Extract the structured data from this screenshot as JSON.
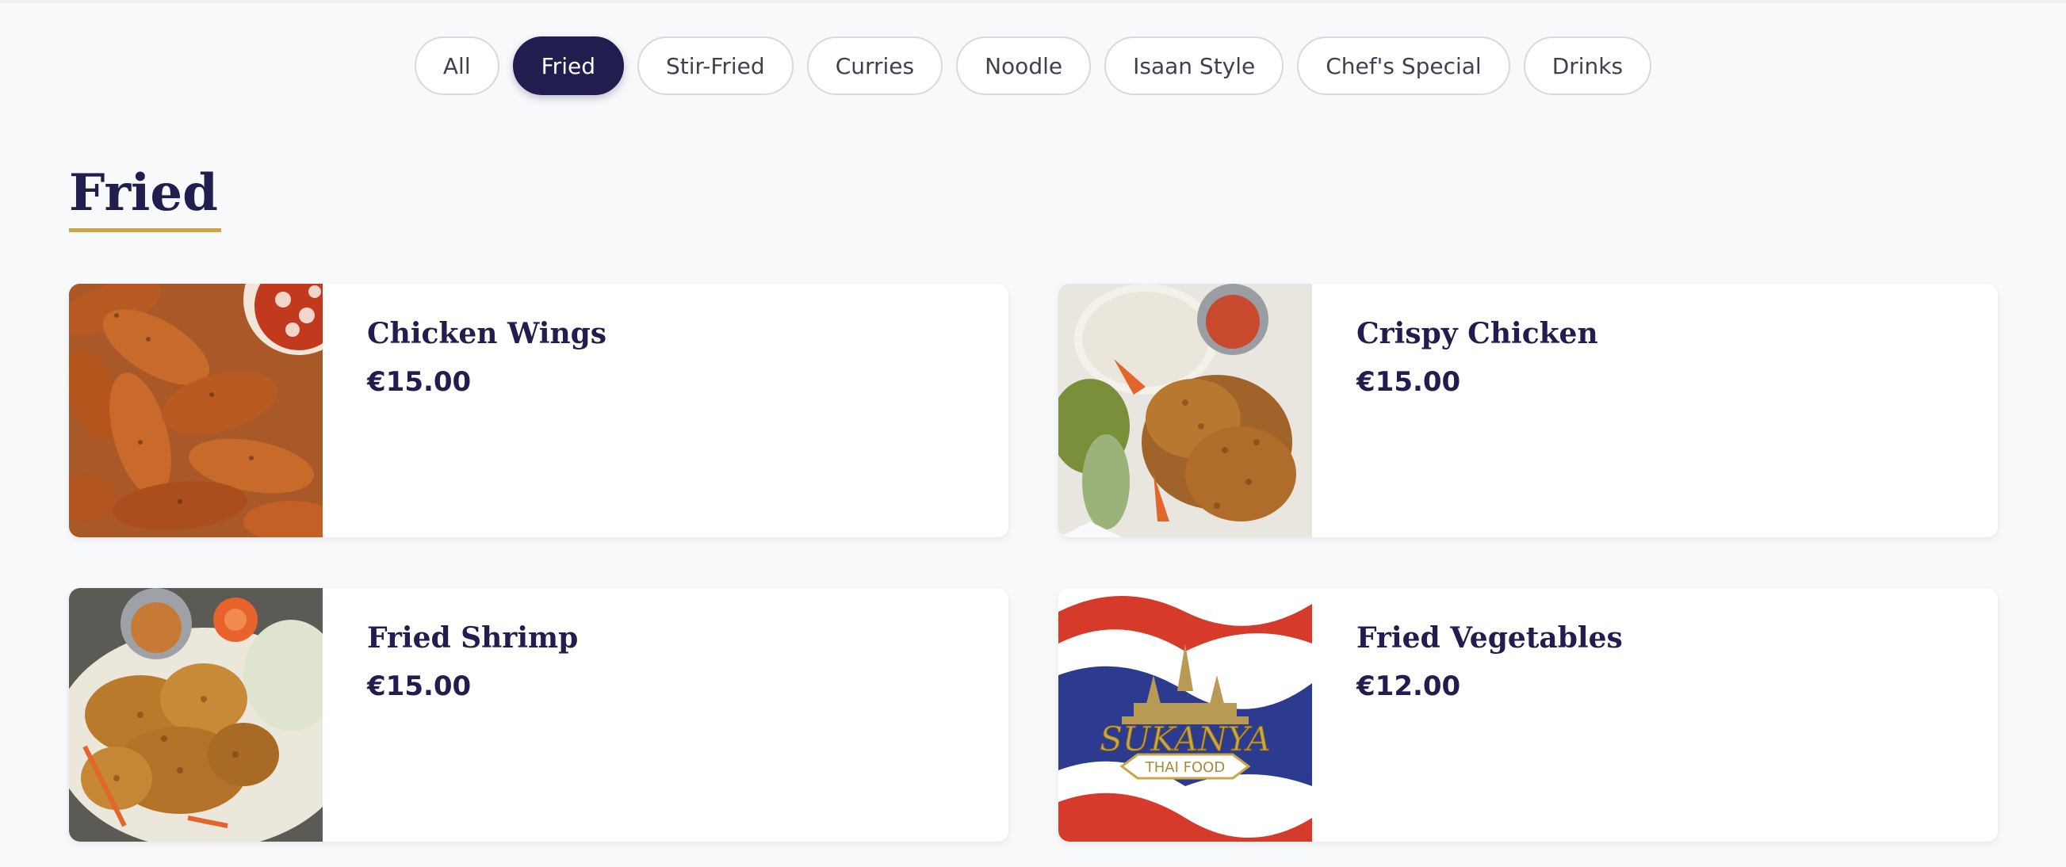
{
  "filters": [
    {
      "label": "All"
    },
    {
      "label": "Fried"
    },
    {
      "label": "Stir-Fried"
    },
    {
      "label": "Curries"
    },
    {
      "label": "Noodle"
    },
    {
      "label": "Isaan Style"
    },
    {
      "label": "Chef's Special"
    },
    {
      "label": "Drinks"
    }
  ],
  "active_filter": "Fried",
  "section": {
    "title": "Fried"
  },
  "items": [
    {
      "name": "Chicken Wings",
      "price": "€15.00",
      "image": "chicken-wings-photo"
    },
    {
      "name": "Crispy Chicken",
      "price": "€15.00",
      "image": "crispy-chicken-photo"
    },
    {
      "name": "Fried Shrimp",
      "price": "€15.00",
      "image": "fried-shrimp-photo"
    },
    {
      "name": "Fried Vegetables",
      "price": "€12.00",
      "image": "sukanya-logo-image"
    }
  ],
  "logo": {
    "brand": "SUKANYA",
    "tagline": "THAI FOOD"
  },
  "colors": {
    "primary": "#221d4f",
    "accent": "#c9a646",
    "background": "#f8f9fb"
  }
}
